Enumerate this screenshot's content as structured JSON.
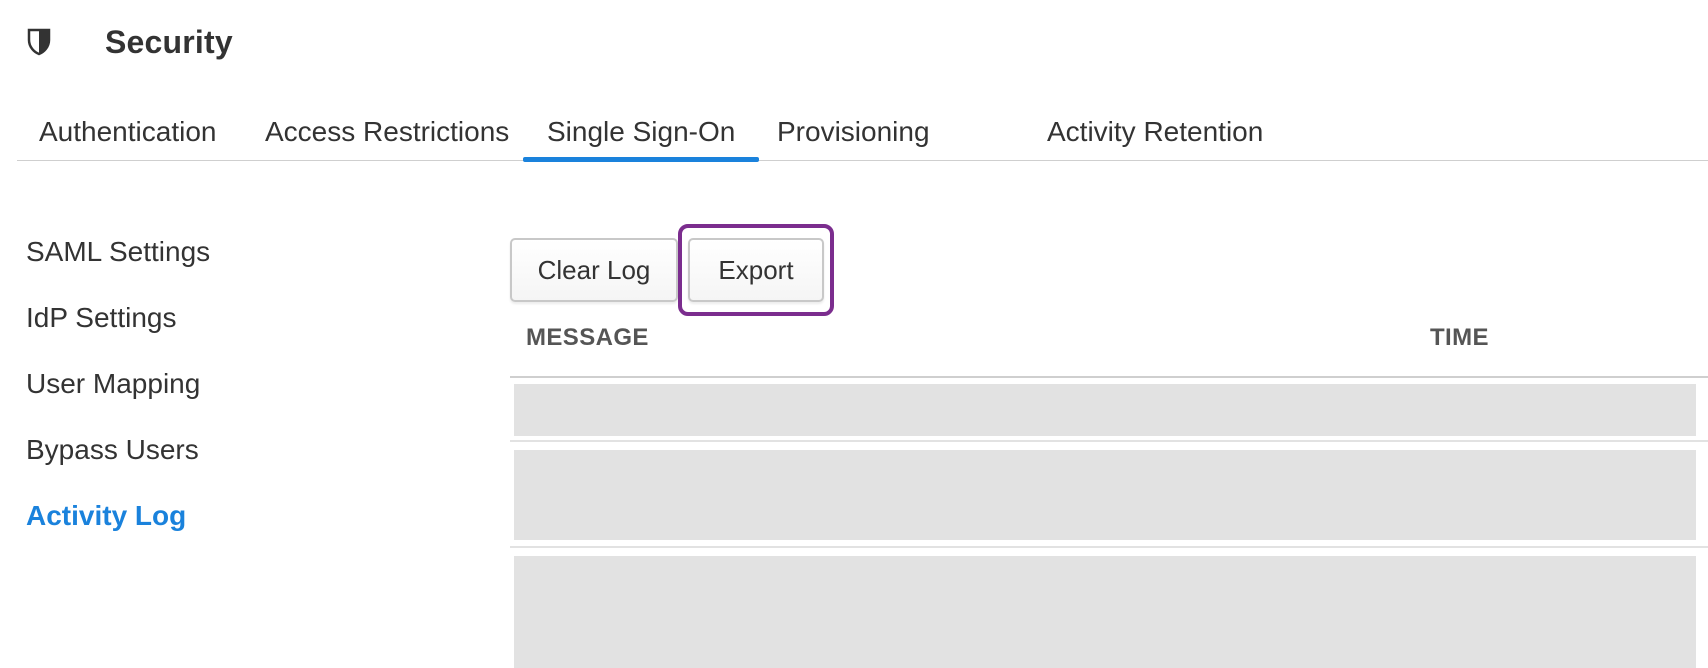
{
  "header": {
    "icon": "shield-icon",
    "title": "Security"
  },
  "tabs": [
    {
      "label": "Authentication",
      "active": false
    },
    {
      "label": "Access Restrictions",
      "active": false
    },
    {
      "label": "Single Sign-On",
      "active": true
    },
    {
      "label": "Provisioning",
      "active": false
    },
    {
      "label": "Activity Retention",
      "active": false
    }
  ],
  "sidenav": {
    "items": [
      {
        "label": "SAML Settings",
        "active": false
      },
      {
        "label": "IdP Settings",
        "active": false
      },
      {
        "label": "User Mapping",
        "active": false
      },
      {
        "label": "Bypass Users",
        "active": false
      },
      {
        "label": "Activity Log",
        "active": true
      }
    ]
  },
  "toolbar": {
    "clear_log_label": "Clear Log",
    "export_label": "Export",
    "highlighted": "Export"
  },
  "table": {
    "columns": [
      "MESSAGE",
      "TIME"
    ],
    "rows": [
      {
        "message": "",
        "time": "",
        "loading": true
      },
      {
        "message": "",
        "time": "",
        "loading": true
      },
      {
        "message": "",
        "time": "",
        "loading": true
      }
    ]
  },
  "colors": {
    "accent": "#1a82dc",
    "highlight": "#7b2d8e",
    "skeleton": "#e2e2e2",
    "text": "#333333"
  }
}
